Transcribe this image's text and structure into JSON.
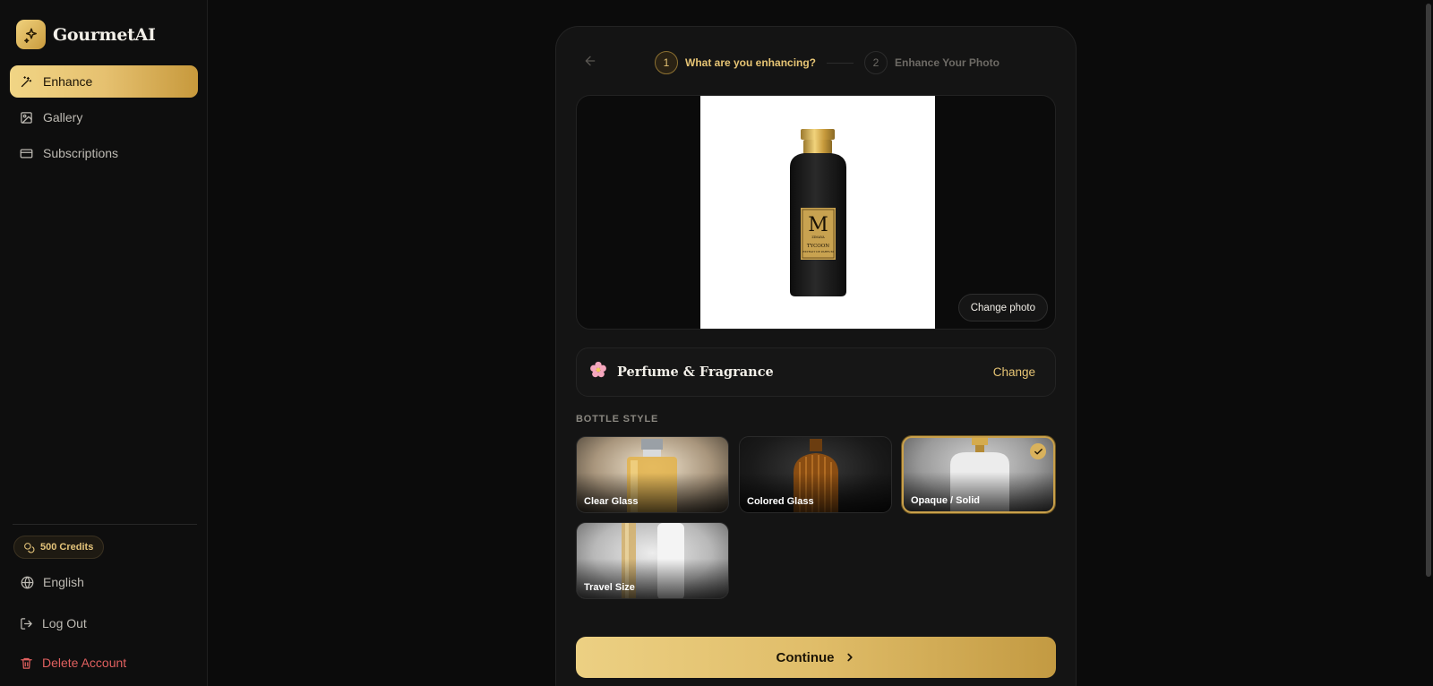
{
  "app": {
    "name": "GourmetAI"
  },
  "sidebar": {
    "items": [
      {
        "label": "Enhance",
        "icon": "magic-wand-icon",
        "active": true
      },
      {
        "label": "Gallery",
        "icon": "image-icon",
        "active": false
      },
      {
        "label": "Subscriptions",
        "icon": "card-icon",
        "active": false
      }
    ],
    "credits": "500 Credits",
    "language": "English",
    "logout": "Log Out",
    "delete_account": "Delete Account"
  },
  "stepper": {
    "steps": [
      {
        "number": "1",
        "label": "What are you enhancing?",
        "active": true
      },
      {
        "number": "2",
        "label": "Enhance Your Photo",
        "active": false
      }
    ]
  },
  "photo": {
    "change_label": "Change photo",
    "product": {
      "monogram": "M",
      "brand_small": "ZIMAYA",
      "name": "TYCOON",
      "sub": "EXTRAIT DE PARFUM"
    }
  },
  "category": {
    "name": "Perfume & Fragrance",
    "icon": "flower-icon",
    "change_label": "Change"
  },
  "bottle_style": {
    "label": "BOTTLE STYLE",
    "options": [
      {
        "label": "Clear Glass",
        "selected": false
      },
      {
        "label": "Colored Glass",
        "selected": false
      },
      {
        "label": "Opaque / Solid",
        "selected": true
      },
      {
        "label": "Travel Size",
        "selected": false
      }
    ]
  },
  "continue_label": "Continue",
  "colors": {
    "accent": "#e6c474",
    "background": "#0b0b0b",
    "danger": "#e0605f"
  }
}
